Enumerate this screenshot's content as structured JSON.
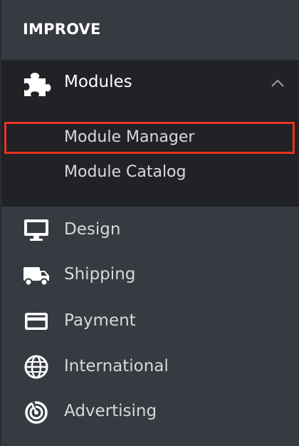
{
  "section": {
    "title": "IMPROVE"
  },
  "modules": {
    "label": "Modules",
    "icon": "puzzle-icon",
    "expanded": true,
    "items": [
      {
        "label": "Module Manager",
        "active": true
      },
      {
        "label": "Module Catalog",
        "active": false
      }
    ]
  },
  "nav": [
    {
      "label": "Design",
      "icon": "monitor-icon"
    },
    {
      "label": "Shipping",
      "icon": "truck-icon"
    },
    {
      "label": "Payment",
      "icon": "credit-card-icon"
    },
    {
      "label": "International",
      "icon": "globe-icon"
    },
    {
      "label": "Advertising",
      "icon": "target-icon"
    }
  ],
  "colors": {
    "sidebar_bg": "#363a41",
    "expanded_bg": "#202226",
    "highlight": "#e7321f",
    "text": "#d6d8dc"
  }
}
